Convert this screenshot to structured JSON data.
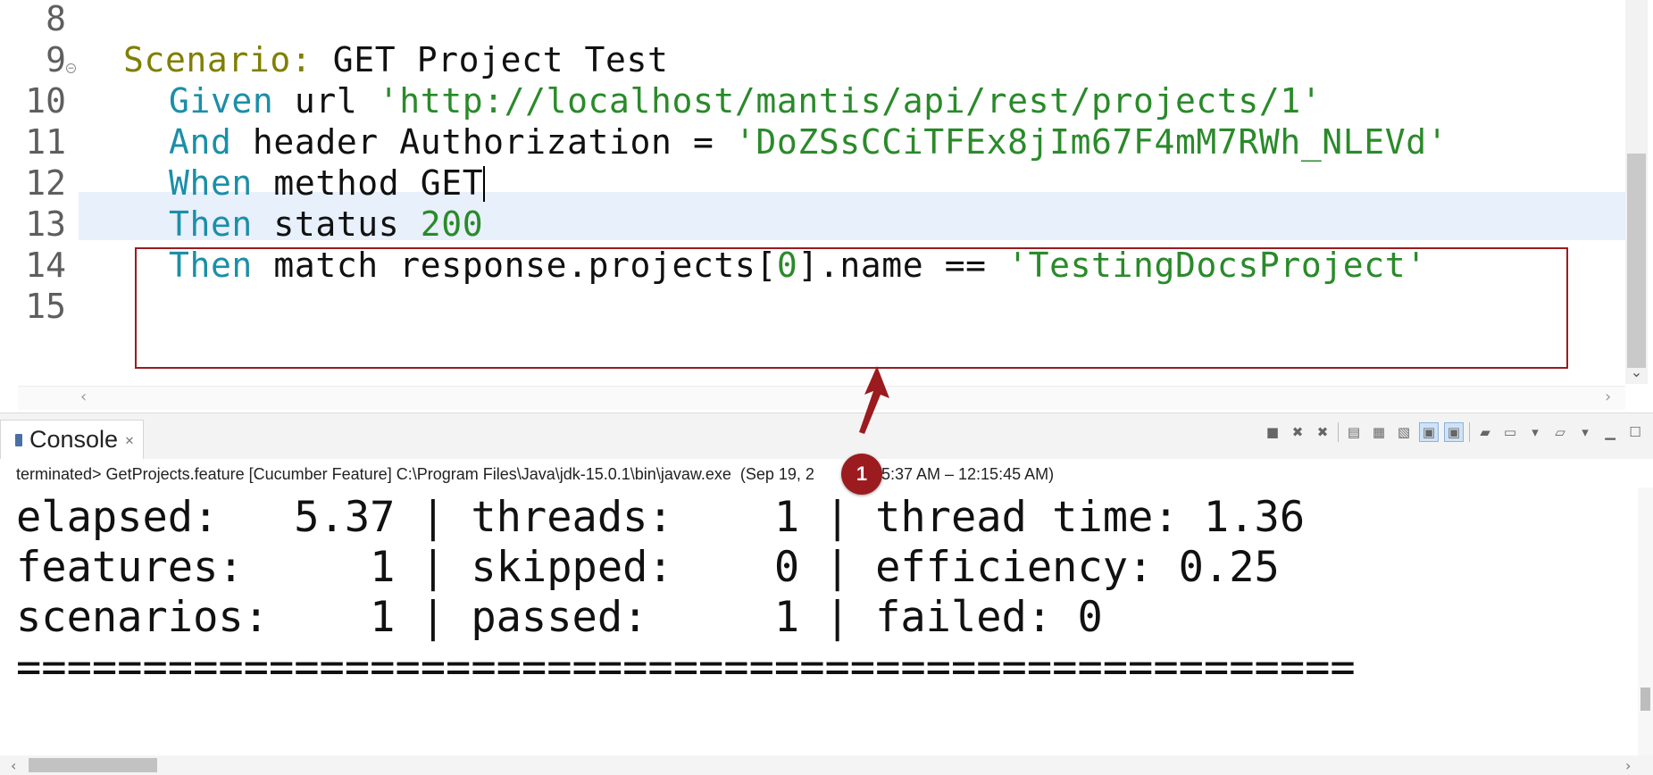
{
  "editor": {
    "line_numbers": [
      "8",
      "9",
      "10",
      "11",
      "12",
      "13",
      "14",
      "15"
    ],
    "lines": [
      {
        "scenario_kw": "Scenario:",
        "scenario_title": " GET Project Test"
      },
      {
        "kw": "Given",
        "text": " url ",
        "str": "'http://localhost/mantis/api/rest/projects/1'"
      },
      {
        "kw": "And",
        "text": " header Authorization = ",
        "str": "'DoZSsCCiTFEx8jIm67F4mM7RWh_NLEVd'"
      },
      {
        "kw": "When",
        "text": " method GET"
      },
      {
        "kw": "Then",
        "text": " status ",
        "num": "200"
      },
      {
        "kw": "Then",
        "text": " match response.projects[",
        "num": "0",
        "text2": "].name == ",
        "str": "'TestingDocsProject'"
      }
    ],
    "fold_icon": "collapse-fold-icon"
  },
  "console": {
    "tab_label": "Console",
    "tab_close": "✕",
    "status": "terminated> GetProjects.feature [Cucumber Feature] C:\\Program Files\\Java\\jdk-15.0.1\\bin\\javaw.exe  (Sep 19, 2",
    "status_tail": "12:15:37 AM – 12:15:45 AM)",
    "output": [
      "elapsed:   5.37 | threads:    1 | thread time: 1.36",
      "features:     1 | skipped:    0 | efficiency: 0.25",
      "scenarios:    1 | passed:     1 | failed: 0",
      "====================================================="
    ]
  },
  "annotation": {
    "badge": "1",
    "color": "#9b1b1f"
  },
  "colors": {
    "scenario_keyword": "#7f7f00",
    "step_keyword": "#1b8fa8",
    "string_literal": "#2a8a2a",
    "current_line": "#e8f0fb"
  }
}
